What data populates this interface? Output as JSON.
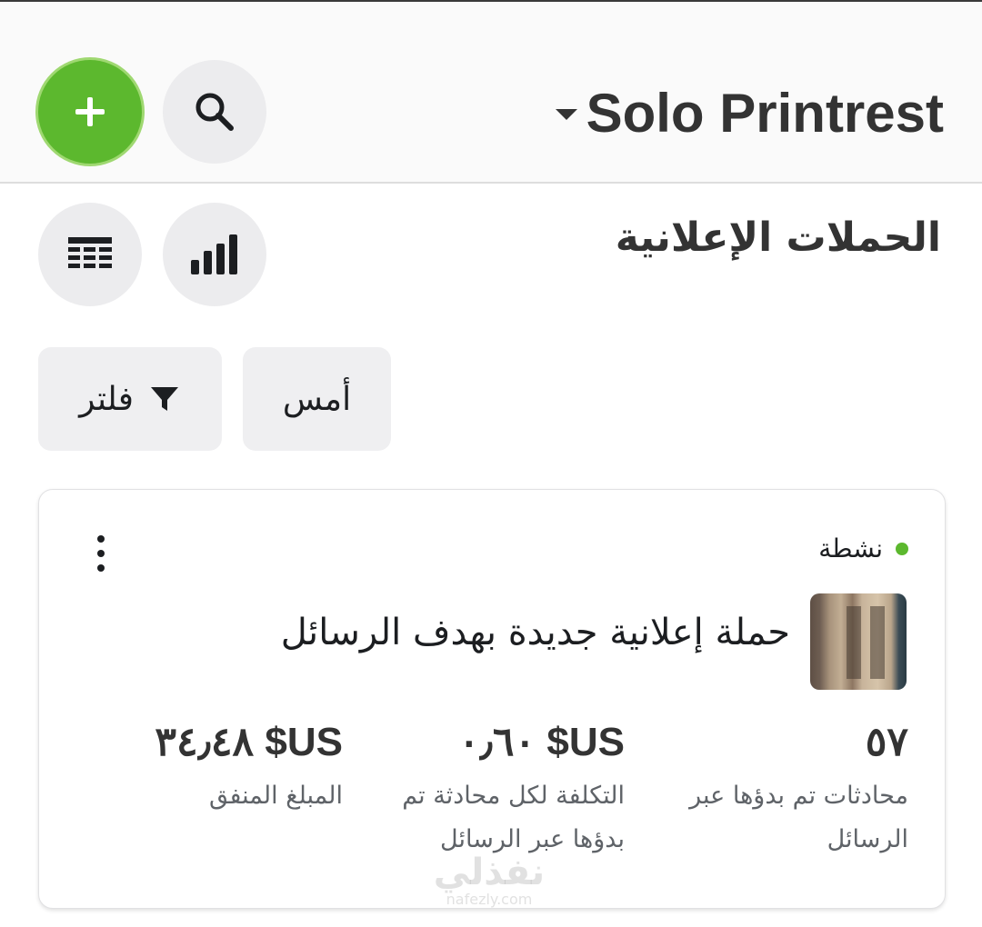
{
  "header": {
    "account_name": "Solo Printrest",
    "icons": [
      "add-icon",
      "search-icon"
    ]
  },
  "page": {
    "title": "الحملات الإعلانية",
    "view_icons": [
      "bar-chart-icon",
      "table-icon"
    ]
  },
  "filters": {
    "date_label": "أمس",
    "filter_label": "فلتر"
  },
  "campaign": {
    "status": "نشطة",
    "status_color": "#5cb82e",
    "name": "حملة إعلانية جديدة بهدف الرسائل",
    "metrics": [
      {
        "value": "٥٧",
        "label": "محادثات تم بدؤها عبر الرسائل"
      },
      {
        "value": "US$ ٠٫٦٠",
        "label": "التكلفة لكل محادثة تم بدؤها عبر الرسائل"
      },
      {
        "value": "US$ ٣٤٫٤٨",
        "label": "المبلغ المنفق"
      }
    ]
  },
  "watermark": {
    "arabic": "نفذلي",
    "latin": "nafezly.com"
  },
  "colors": {
    "accent_green": "#5cb82e",
    "button_gray": "#ececee",
    "text_dark": "#333333"
  }
}
